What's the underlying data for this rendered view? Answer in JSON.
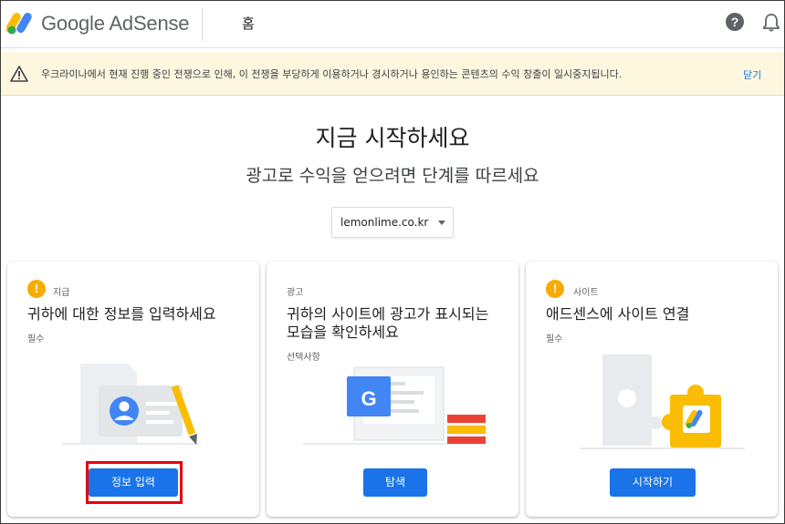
{
  "header": {
    "brand": "Google AdSense",
    "page_title": "홈",
    "help_glyph": "?"
  },
  "banner": {
    "message": "우크라이나에서 현재 진행 중인 전쟁으로 인해, 이 전쟁을 부당하게 이용하거나 경시하거나 용인하는 콘텐츠의 수익 창출이 일시중지됩니다.",
    "close_label": "닫기"
  },
  "hero": {
    "title": "지금 시작하세요",
    "subtitle": "광고로 수익을 얻으려면 단계를 따르세요"
  },
  "site_select": {
    "value": "lemonlime.co.kr"
  },
  "cards": [
    {
      "tag": "지급",
      "title": "귀하에 대한 정보를 입력하세요",
      "requirement": "필수",
      "button": "정보 입력",
      "warn_glyph": "!"
    },
    {
      "tag": "광고",
      "title": "귀하의 사이트에 광고가 표시되는 모습을 확인하세요",
      "requirement": "선택사항",
      "button": "탐색"
    },
    {
      "tag": "사이트",
      "title": "애드센스에 사이트 연결",
      "requirement": "필수",
      "button": "시작하기",
      "warn_glyph": "!"
    }
  ],
  "colors": {
    "accent": "#1a73e8",
    "warning": "#f9ab00",
    "banner_bg": "#fef7e0",
    "highlight": "#e60012"
  },
  "illustrations": {
    "g_glyph": "G"
  }
}
